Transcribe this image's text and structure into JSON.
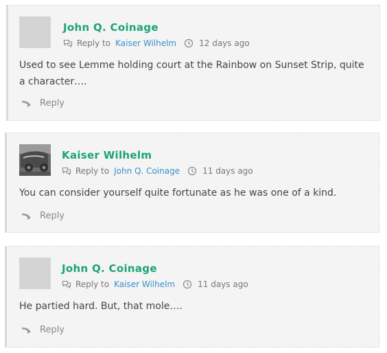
{
  "comments": [
    {
      "author": "John Q. Coinage",
      "reply_to_label": "Reply to",
      "reply_to": "Kaiser Wilhelm",
      "time": "12 days ago",
      "text_line1": "Used to see Lemme holding court at the Rainbow on Sunset Strip, quite",
      "text_line2": "a character….",
      "reply_label": "Reply"
    },
    {
      "author": "Kaiser Wilhelm",
      "reply_to_label": "Reply to",
      "reply_to": "John Q. Coinage",
      "time": "11 days ago",
      "text_line1": "You can consider yourself quite fortunate as he was one of a kind.",
      "reply_label": "Reply"
    },
    {
      "author": "John Q. Coinage",
      "reply_to_label": "Reply to",
      "reply_to": "Kaiser Wilhelm",
      "time": "11 days ago",
      "text_line1": "He partied hard. But, that mole….",
      "reply_label": "Reply"
    }
  ],
  "colors": {
    "author": "#1aa37a",
    "link": "#3a8fc7",
    "panel": "#f4f4f4"
  },
  "icons": {
    "reply_to": "chat-bubbles-icon",
    "time": "clock-icon",
    "reply": "reply-arrow-icon"
  }
}
